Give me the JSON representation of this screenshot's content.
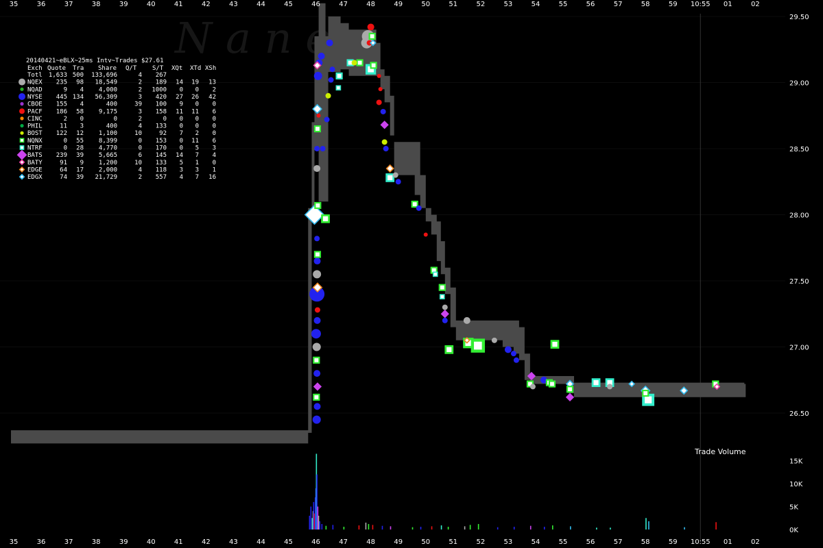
{
  "watermark": "N a n e x",
  "chart_data": {
    "type": "scatter",
    "title": "20140421~eBLX~25ms Intv~Trades $27.61",
    "x_tick_labels": [
      "35",
      "36",
      "37",
      "38",
      "39",
      "40",
      "41",
      "42",
      "43",
      "44",
      "45",
      "46",
      "47",
      "48",
      "49",
      "50",
      "51",
      "52",
      "53",
      "54",
      "55",
      "56",
      "57",
      "58",
      "59",
      "10:55",
      "01",
      "02"
    ],
    "x_seconds": [
      35,
      36,
      37,
      38,
      39,
      40,
      41,
      42,
      43,
      44,
      45,
      46,
      47,
      48,
      49,
      50,
      51,
      52,
      53,
      54,
      55,
      56,
      57,
      58,
      59,
      60,
      61,
      62
    ],
    "y_ticks": [
      26.5,
      27.0,
      27.5,
      28.0,
      28.5,
      29.0,
      29.5
    ],
    "y_tick_labels": [
      "26.50",
      "27.00",
      "27.50",
      "28.00",
      "28.50",
      "29.00",
      "29.50"
    ],
    "ylim": [
      26.0,
      29.6
    ],
    "volume_label": "Trade Volume",
    "volume_ticks": [
      "0K",
      "5K",
      "10K",
      "15K"
    ],
    "volume_tick_values": [
      0,
      5000,
      10000,
      15000
    ],
    "marker_line_x": "10:55",
    "table_header": [
      "Exch",
      "Quote",
      "Tra",
      "Share",
      "Q/T",
      "S/T",
      "XQt",
      "XTd",
      "XSh"
    ],
    "table_rows": [
      {
        "exch": "Totl",
        "color": "",
        "shape": "",
        "quote": "1,633",
        "tra": "500",
        "share": "133,696",
        "qt": "4",
        "st": "267",
        "xqt": "",
        "xtd": "",
        "xsh": ""
      },
      {
        "exch": "NQEX",
        "color": "#aaaaaa",
        "shape": "circle-lg",
        "quote": "235",
        "tra": "98",
        "share": "18,549",
        "qt": "2",
        "st": "189",
        "xqt": "14",
        "xtd": "19",
        "xsh": "13"
      },
      {
        "exch": "NQAD",
        "color": "#22aa22",
        "shape": "circle",
        "quote": "9",
        "tra": "4",
        "share": "4,000",
        "qt": "2",
        "st": "1000",
        "xqt": "0",
        "xtd": "0",
        "xsh": "2"
      },
      {
        "exch": "NYSE",
        "color": "#2222ee",
        "shape": "circle-lg",
        "quote": "445",
        "tra": "134",
        "share": "56,309",
        "qt": "3",
        "st": "420",
        "xqt": "27",
        "xtd": "26",
        "xsh": "42"
      },
      {
        "exch": "CBOE",
        "color": "#9933cc",
        "shape": "circle",
        "quote": "155",
        "tra": "4",
        "share": "400",
        "qt": "39",
        "st": "100",
        "xqt": "9",
        "xtd": "0",
        "xsh": "0"
      },
      {
        "exch": "PACF",
        "color": "#ee1111",
        "shape": "circle-md",
        "quote": "186",
        "tra": "58",
        "share": "9,175",
        "qt": "3",
        "st": "158",
        "xqt": "11",
        "xtd": "11",
        "xsh": "6"
      },
      {
        "exch": "CINC",
        "color": "#ff8800",
        "shape": "circle",
        "quote": "2",
        "tra": "0",
        "share": "0",
        "qt": "2",
        "st": "0",
        "xqt": "0",
        "xtd": "0",
        "xsh": "0"
      },
      {
        "exch": "PHIL",
        "color": "#00aa44",
        "shape": "circle",
        "quote": "11",
        "tra": "3",
        "share": "400",
        "qt": "4",
        "st": "133",
        "xqt": "0",
        "xtd": "0",
        "xsh": "0"
      },
      {
        "exch": "BOST",
        "color": "#ccee00",
        "shape": "circle",
        "quote": "122",
        "tra": "12",
        "share": "1,100",
        "qt": "10",
        "st": "92",
        "xqt": "7",
        "xtd": "2",
        "xsh": "0"
      },
      {
        "exch": "NQNX",
        "color": "#33ee33",
        "shape": "square",
        "quote": "0",
        "tra": "55",
        "share": "8,399",
        "qt": "0",
        "st": "153",
        "xqt": "0",
        "xtd": "11",
        "xsh": "6"
      },
      {
        "exch": "NTRF",
        "color": "#33eecc",
        "shape": "square",
        "quote": "0",
        "tra": "28",
        "share": "4,770",
        "qt": "0",
        "st": "170",
        "xqt": "0",
        "xtd": "5",
        "xsh": "3"
      },
      {
        "exch": "BATS",
        "color": "#cc44ee",
        "shape": "diamond-lg",
        "quote": "239",
        "tra": "39",
        "share": "5,665",
        "qt": "6",
        "st": "145",
        "xqt": "14",
        "xtd": "7",
        "xsh": "4"
      },
      {
        "exch": "BATY",
        "color": "#ee44aa",
        "shape": "diamond",
        "quote": "91",
        "tra": "9",
        "share": "1,200",
        "qt": "10",
        "st": "133",
        "xqt": "5",
        "xtd": "1",
        "xsh": "0"
      },
      {
        "exch": "EDGE",
        "color": "#ee8822",
        "shape": "diamond",
        "quote": "64",
        "tra": "17",
        "share": "2,000",
        "qt": "4",
        "st": "118",
        "xqt": "3",
        "xtd": "3",
        "xsh": "1"
      },
      {
        "exch": "EDGX",
        "color": "#33bbee",
        "shape": "diamond",
        "quote": "74",
        "tra": "39",
        "share": "21,729",
        "qt": "2",
        "st": "557",
        "xqt": "4",
        "xtd": "7",
        "xsh": "16"
      }
    ],
    "nbbo_band": [
      [
        34.9,
        26.27,
        26.37
      ],
      [
        45.7,
        26.27,
        26.37
      ],
      [
        45.72,
        26.35,
        28.05
      ],
      [
        45.85,
        28.0,
        28.7
      ],
      [
        45.95,
        28.5,
        29.35
      ],
      [
        46.1,
        28.1,
        29.6
      ],
      [
        46.35,
        28.1,
        29.35
      ],
      [
        46.45,
        29.08,
        29.5
      ],
      [
        46.9,
        29.1,
        29.45
      ],
      [
        47.2,
        29.05,
        29.4
      ],
      [
        47.8,
        29.05,
        29.4
      ],
      [
        48.2,
        29.05,
        29.3
      ],
      [
        48.35,
        28.95,
        29.1
      ],
      [
        48.5,
        28.85,
        29.05
      ],
      [
        48.7,
        28.6,
        28.9
      ],
      [
        48.85,
        28.3,
        28.55
      ],
      [
        49.6,
        28.15,
        28.55
      ],
      [
        49.8,
        28.05,
        28.3
      ],
      [
        50.0,
        27.95,
        28.05
      ],
      [
        50.2,
        27.85,
        28.0
      ],
      [
        50.4,
        27.65,
        27.95
      ],
      [
        50.55,
        27.55,
        27.8
      ],
      [
        50.7,
        27.4,
        27.6
      ],
      [
        50.9,
        27.15,
        27.45
      ],
      [
        51.1,
        27.05,
        27.2
      ],
      [
        51.3,
        27.05,
        27.2
      ],
      [
        52.8,
        27.0,
        27.2
      ],
      [
        53.0,
        27.0,
        27.2
      ],
      [
        53.2,
        26.95,
        27.2
      ],
      [
        53.4,
        26.9,
        27.15
      ],
      [
        53.6,
        26.75,
        26.95
      ],
      [
        53.8,
        26.72,
        26.78
      ],
      [
        55.2,
        26.65,
        26.78
      ],
      [
        55.4,
        26.62,
        26.73
      ],
      [
        61.6,
        26.62,
        26.72
      ]
    ],
    "trades": [
      {
        "x": 46.03,
        "y": 26.45,
        "ex": "NYSE",
        "s": 6
      },
      {
        "x": 46.05,
        "y": 26.55,
        "ex": "NYSE",
        "s": 5
      },
      {
        "x": 46.02,
        "y": 26.62,
        "ex": "NQNX",
        "s": 4
      },
      {
        "x": 46.06,
        "y": 26.7,
        "ex": "BATS",
        "s": 4
      },
      {
        "x": 46.04,
        "y": 26.8,
        "ex": "NYSE",
        "s": 5
      },
      {
        "x": 46.02,
        "y": 26.9,
        "ex": "NQNX",
        "s": 4
      },
      {
        "x": 46.03,
        "y": 27.0,
        "ex": "NQEX",
        "s": 6
      },
      {
        "x": 46.01,
        "y": 27.1,
        "ex": "NYSE",
        "s": 7
      },
      {
        "x": 46.05,
        "y": 27.2,
        "ex": "NYSE",
        "s": 5
      },
      {
        "x": 46.06,
        "y": 27.28,
        "ex": "PACF",
        "s": 4
      },
      {
        "x": 46.04,
        "y": 27.4,
        "ex": "NYSE",
        "s": 11
      },
      {
        "x": 46.06,
        "y": 27.45,
        "ex": "EDGE",
        "s": 5
      },
      {
        "x": 46.04,
        "y": 27.55,
        "ex": "NQEX",
        "s": 6
      },
      {
        "x": 46.05,
        "y": 27.65,
        "ex": "NYSE",
        "s": 5
      },
      {
        "x": 46.06,
        "y": 27.7,
        "ex": "NQNX",
        "s": 4
      },
      {
        "x": 46.04,
        "y": 27.82,
        "ex": "NYSE",
        "s": 4
      },
      {
        "x": 45.95,
        "y": 28.0,
        "ex": "EDGX",
        "s": 11
      },
      {
        "x": 46.35,
        "y": 27.97,
        "ex": "NQNX",
        "s": 5
      },
      {
        "x": 46.07,
        "y": 28.07,
        "ex": "NQNX",
        "s": 4
      },
      {
        "x": 46.04,
        "y": 28.35,
        "ex": "NQEX",
        "s": 5
      },
      {
        "x": 46.04,
        "y": 28.5,
        "ex": "NYSE",
        "s": 4
      },
      {
        "x": 46.06,
        "y": 28.65,
        "ex": "NQNX",
        "s": 4
      },
      {
        "x": 46.05,
        "y": 28.8,
        "ex": "EDGX",
        "s": 5
      },
      {
        "x": 46.1,
        "y": 28.75,
        "ex": "PACF",
        "s": 3
      },
      {
        "x": 46.08,
        "y": 29.05,
        "ex": "NYSE",
        "s": 6
      },
      {
        "x": 46.12,
        "y": 29.15,
        "ex": "NYSE",
        "s": 5
      },
      {
        "x": 46.05,
        "y": 29.13,
        "ex": "BATY",
        "s": 4
      },
      {
        "x": 46.2,
        "y": 29.2,
        "ex": "NYSE",
        "s": 5
      },
      {
        "x": 46.5,
        "y": 29.3,
        "ex": "NYSE",
        "s": 5
      },
      {
        "x": 46.6,
        "y": 29.1,
        "ex": "NYSE",
        "s": 4
      },
      {
        "x": 46.55,
        "y": 29.02,
        "ex": "NYSE",
        "s": 4
      },
      {
        "x": 46.4,
        "y": 28.72,
        "ex": "NYSE",
        "s": 4
      },
      {
        "x": 46.25,
        "y": 28.5,
        "ex": "NYSE",
        "s": 4
      },
      {
        "x": 46.45,
        "y": 28.9,
        "ex": "BOST",
        "s": 4
      },
      {
        "x": 46.85,
        "y": 29.05,
        "ex": "NTRF",
        "s": 4
      },
      {
        "x": 46.82,
        "y": 28.96,
        "ex": "NTRF",
        "s": 3
      },
      {
        "x": 47.25,
        "y": 29.15,
        "ex": "NTRF",
        "s": 4
      },
      {
        "x": 47.6,
        "y": 29.15,
        "ex": "NQNX",
        "s": 4
      },
      {
        "x": 47.4,
        "y": 29.15,
        "ex": "BOST",
        "s": 4
      },
      {
        "x": 47.9,
        "y": 29.35,
        "ex": "NQEX",
        "s": 9
      },
      {
        "x": 47.85,
        "y": 29.3,
        "ex": "NQEX",
        "s": 8
      },
      {
        "x": 48.0,
        "y": 29.42,
        "ex": "PACF",
        "s": 5
      },
      {
        "x": 47.95,
        "y": 29.3,
        "ex": "PACF",
        "s": 4
      },
      {
        "x": 48.05,
        "y": 29.35,
        "ex": "NQNX",
        "s": 4
      },
      {
        "x": 48.08,
        "y": 29.3,
        "ex": "EDGX",
        "s": 3
      },
      {
        "x": 48.0,
        "y": 29.1,
        "ex": "NTRF",
        "s": 6
      },
      {
        "x": 48.1,
        "y": 29.13,
        "ex": "NQNX",
        "s": 4
      },
      {
        "x": 48.3,
        "y": 29.05,
        "ex": "PACF",
        "s": 3
      },
      {
        "x": 48.35,
        "y": 28.95,
        "ex": "PACF",
        "s": 3
      },
      {
        "x": 48.3,
        "y": 28.85,
        "ex": "PACF",
        "s": 4
      },
      {
        "x": 48.45,
        "y": 28.78,
        "ex": "NYSE",
        "s": 4
      },
      {
        "x": 48.5,
        "y": 28.68,
        "ex": "BATS",
        "s": 4
      },
      {
        "x": 48.5,
        "y": 28.55,
        "ex": "BOST",
        "s": 4
      },
      {
        "x": 48.55,
        "y": 28.5,
        "ex": "NYSE",
        "s": 4
      },
      {
        "x": 48.7,
        "y": 28.35,
        "ex": "EDGE",
        "s": 4
      },
      {
        "x": 48.7,
        "y": 28.28,
        "ex": "NTRF",
        "s": 5
      },
      {
        "x": 48.9,
        "y": 28.3,
        "ex": "NQEX",
        "s": 4
      },
      {
        "x": 49.0,
        "y": 28.25,
        "ex": "NYSE",
        "s": 4
      },
      {
        "x": 49.6,
        "y": 28.08,
        "ex": "NQNX",
        "s": 4
      },
      {
        "x": 49.75,
        "y": 28.05,
        "ex": "NYSE",
        "s": 4
      },
      {
        "x": 50.0,
        "y": 27.85,
        "ex": "PACF",
        "s": 3
      },
      {
        "x": 50.3,
        "y": 27.58,
        "ex": "NQNX",
        "s": 4
      },
      {
        "x": 50.35,
        "y": 27.55,
        "ex": "NTRF",
        "s": 3
      },
      {
        "x": 50.6,
        "y": 27.45,
        "ex": "NQNX",
        "s": 4
      },
      {
        "x": 50.6,
        "y": 27.38,
        "ex": "NTRF",
        "s": 3
      },
      {
        "x": 50.7,
        "y": 27.3,
        "ex": "NQEX",
        "s": 4
      },
      {
        "x": 50.7,
        "y": 27.25,
        "ex": "BATS",
        "s": 4
      },
      {
        "x": 50.7,
        "y": 27.2,
        "ex": "NYSE",
        "s": 4
      },
      {
        "x": 50.85,
        "y": 26.98,
        "ex": "NQNX",
        "s": 5
      },
      {
        "x": 51.5,
        "y": 27.2,
        "ex": "NQEX",
        "s": 5
      },
      {
        "x": 51.55,
        "y": 27.03,
        "ex": "NQNX",
        "s": 6
      },
      {
        "x": 51.5,
        "y": 27.05,
        "ex": "EDGE",
        "s": 3
      },
      {
        "x": 51.9,
        "y": 27.01,
        "ex": "NQNX",
        "s": 8
      },
      {
        "x": 52.5,
        "y": 27.05,
        "ex": "NQEX",
        "s": 4
      },
      {
        "x": 53.0,
        "y": 26.98,
        "ex": "NYSE",
        "s": 5
      },
      {
        "x": 53.2,
        "y": 26.95,
        "ex": "NYSE",
        "s": 4
      },
      {
        "x": 53.3,
        "y": 26.9,
        "ex": "NYSE",
        "s": 4
      },
      {
        "x": 53.85,
        "y": 26.78,
        "ex": "BATS",
        "s": 4
      },
      {
        "x": 53.8,
        "y": 26.72,
        "ex": "NQNX",
        "s": 4
      },
      {
        "x": 53.9,
        "y": 26.7,
        "ex": "NQEX",
        "s": 4
      },
      {
        "x": 54.3,
        "y": 26.75,
        "ex": "NYSE",
        "s": 5
      },
      {
        "x": 54.5,
        "y": 26.73,
        "ex": "NQNX",
        "s": 4
      },
      {
        "x": 54.6,
        "y": 26.72,
        "ex": "NQNX",
        "s": 4
      },
      {
        "x": 54.7,
        "y": 27.02,
        "ex": "NQNX",
        "s": 5
      },
      {
        "x": 55.25,
        "y": 26.72,
        "ex": "EDGX",
        "s": 4
      },
      {
        "x": 55.25,
        "y": 26.68,
        "ex": "NQNX",
        "s": 4
      },
      {
        "x": 55.25,
        "y": 26.62,
        "ex": "BATS",
        "s": 4
      },
      {
        "x": 56.2,
        "y": 26.73,
        "ex": "NTRF",
        "s": 5
      },
      {
        "x": 56.7,
        "y": 26.73,
        "ex": "NTRF",
        "s": 5
      },
      {
        "x": 56.7,
        "y": 26.7,
        "ex": "NQEX",
        "s": 4
      },
      {
        "x": 57.5,
        "y": 26.72,
        "ex": "EDGX",
        "s": 3
      },
      {
        "x": 58.0,
        "y": 26.67,
        "ex": "EDGX",
        "s": 5
      },
      {
        "x": 58.1,
        "y": 26.6,
        "ex": "NTRF",
        "s": 7
      },
      {
        "x": 58.0,
        "y": 26.65,
        "ex": "NQNX",
        "s": 4
      },
      {
        "x": 59.4,
        "y": 26.67,
        "ex": "EDGX",
        "s": 4
      },
      {
        "x": 60.55,
        "y": 26.72,
        "ex": "NQNX",
        "s": 4
      },
      {
        "x": 60.6,
        "y": 26.7,
        "ex": "BATY",
        "s": 3
      }
    ],
    "volume_bars": [
      [
        45.75,
        3000,
        "NYSE"
      ],
      [
        45.8,
        5000,
        "NYSE"
      ],
      [
        45.85,
        2500,
        "NTRF"
      ],
      [
        45.88,
        4000,
        "NQEX"
      ],
      [
        45.9,
        6000,
        "NYSE"
      ],
      [
        45.93,
        3500,
        "PACF"
      ],
      [
        45.96,
        7000,
        "NYSE"
      ],
      [
        45.98,
        9000,
        "NYSE"
      ],
      [
        46.0,
        16500,
        "NTRF"
      ],
      [
        46.02,
        12000,
        "NYSE"
      ],
      [
        46.05,
        5000,
        "BATS"
      ],
      [
        46.08,
        3000,
        "NQEX"
      ],
      [
        46.12,
        1800,
        "NYSE"
      ],
      [
        46.2,
        1200,
        "NYSE"
      ],
      [
        46.35,
        800,
        "NQNX"
      ],
      [
        46.6,
        1000,
        "NYSE"
      ],
      [
        47.0,
        600,
        "NQNX"
      ],
      [
        47.55,
        900,
        "PACF"
      ],
      [
        47.8,
        1500,
        "NQEX"
      ],
      [
        47.9,
        1200,
        "NQNX"
      ],
      [
        48.05,
        1000,
        "PACF"
      ],
      [
        48.4,
        800,
        "NYSE"
      ],
      [
        48.7,
        700,
        "BATS"
      ],
      [
        49.5,
        500,
        "NQNX"
      ],
      [
        49.8,
        600,
        "NYSE"
      ],
      [
        50.2,
        700,
        "PACF"
      ],
      [
        50.55,
        900,
        "NTRF"
      ],
      [
        50.8,
        600,
        "NQNX"
      ],
      [
        51.4,
        700,
        "NQEX"
      ],
      [
        51.6,
        1000,
        "NQNX"
      ],
      [
        51.9,
        1200,
        "NQNX"
      ],
      [
        52.6,
        500,
        "NYSE"
      ],
      [
        53.2,
        600,
        "NYSE"
      ],
      [
        53.8,
        800,
        "BATS"
      ],
      [
        54.3,
        600,
        "NYSE"
      ],
      [
        54.6,
        900,
        "NQNX"
      ],
      [
        55.25,
        700,
        "EDGX"
      ],
      [
        56.2,
        400,
        "NTRF"
      ],
      [
        56.7,
        400,
        "NTRF"
      ],
      [
        58.0,
        2500,
        "NTRF"
      ],
      [
        58.1,
        1800,
        "EDGX"
      ],
      [
        59.4,
        500,
        "EDGX"
      ],
      [
        60.55,
        1600,
        "PACF"
      ]
    ]
  }
}
